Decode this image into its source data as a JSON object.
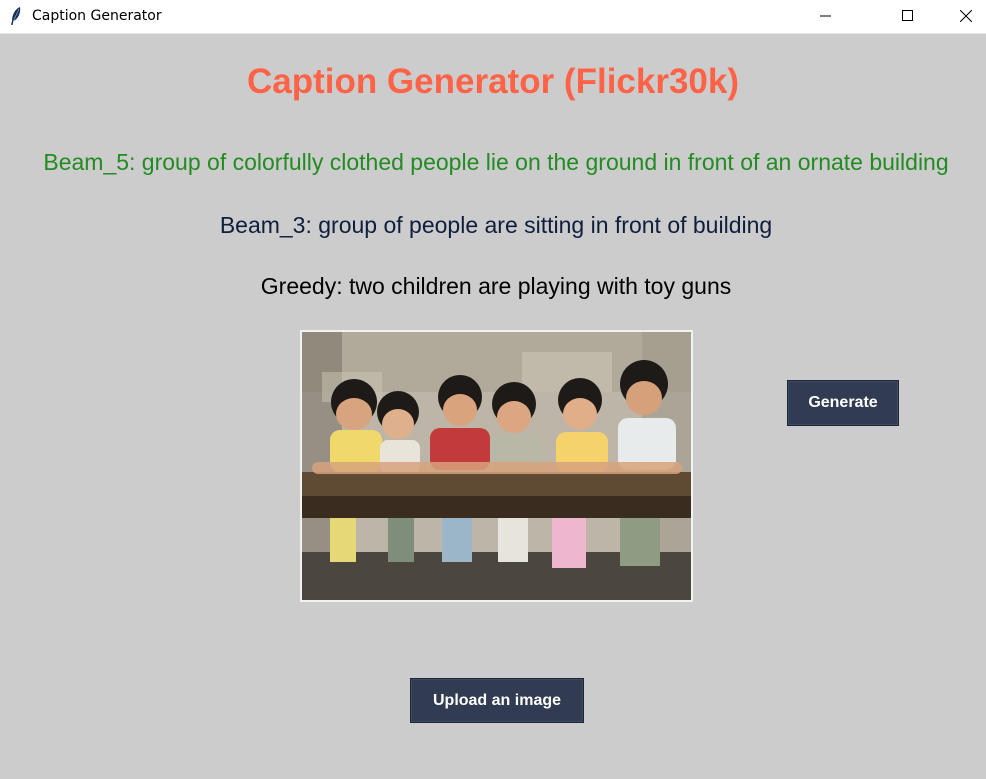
{
  "window": {
    "title": "Caption Generator",
    "icon": "feather-icon"
  },
  "header": {
    "title": "Caption Generator (Flickr30k)",
    "title_color": "#ff6347"
  },
  "captions": {
    "beam5": {
      "text": "Beam_5: group of colorfully clothed people lie on the ground in front of an ornate building",
      "color": "#228b22"
    },
    "beam3": {
      "text": "Beam_3: group of people are sitting in front of building",
      "color": "#0f1e3d"
    },
    "greedy": {
      "text": "Greedy: two children are playing with toy guns",
      "color": "#000000"
    }
  },
  "image": {
    "subject": "six children sitting at a wooden table"
  },
  "buttons": {
    "generate": "Generate",
    "upload": "Upload an image",
    "color": "#313b51"
  }
}
